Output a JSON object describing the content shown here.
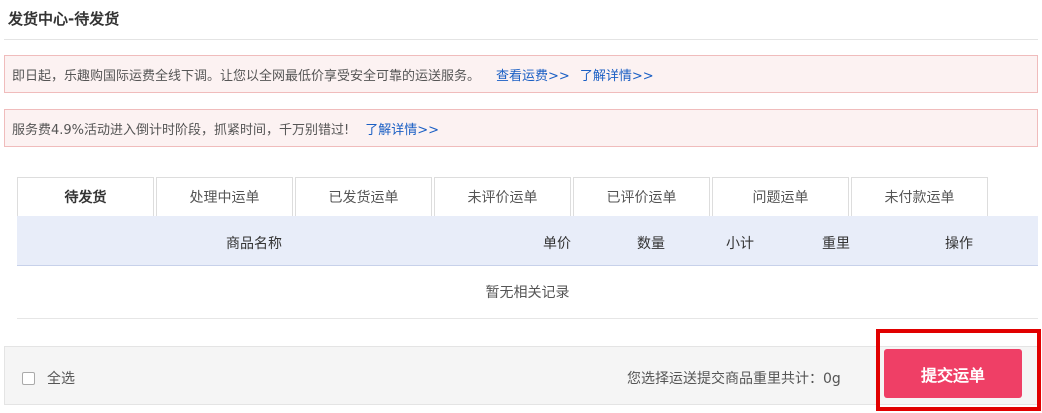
{
  "page": {
    "title": "发货中心-待发货"
  },
  "notices": [
    {
      "text": "即日起，乐趣购国际运费全线下调。让您以全网最低价享受安全可靠的运送服务。",
      "links": [
        "查看运费>>",
        "了解详情>>"
      ]
    },
    {
      "text": "服务费4.9%活动进入倒计时阶段，抓紧时间，千万别错过!",
      "links": [
        "了解详情>>"
      ]
    }
  ],
  "tabs": [
    {
      "label": "待发货",
      "active": true
    },
    {
      "label": "处理中运单",
      "active": false
    },
    {
      "label": "已发货运单",
      "active": false
    },
    {
      "label": "未评价运单",
      "active": false
    },
    {
      "label": "已评价运单",
      "active": false
    },
    {
      "label": "问题运单",
      "active": false
    },
    {
      "label": "未付款运单",
      "active": false
    }
  ],
  "table": {
    "columns": [
      "商品名称",
      "单价",
      "数量",
      "小计",
      "重里",
      "操作"
    ],
    "empty_text": "暂无相关记录"
  },
  "footer": {
    "select_all_label": "全选",
    "summary_text": "您选择运送提交商品重里共计：0g",
    "submit_label": "提交运单"
  },
  "colors": {
    "link": "#1a5fc4",
    "notice_bg": "#fcf2f2",
    "notice_border": "#f0bcbc",
    "header_bg": "#e8edf9",
    "submit_bg": "#ef3f66",
    "highlight": "#e10000"
  }
}
